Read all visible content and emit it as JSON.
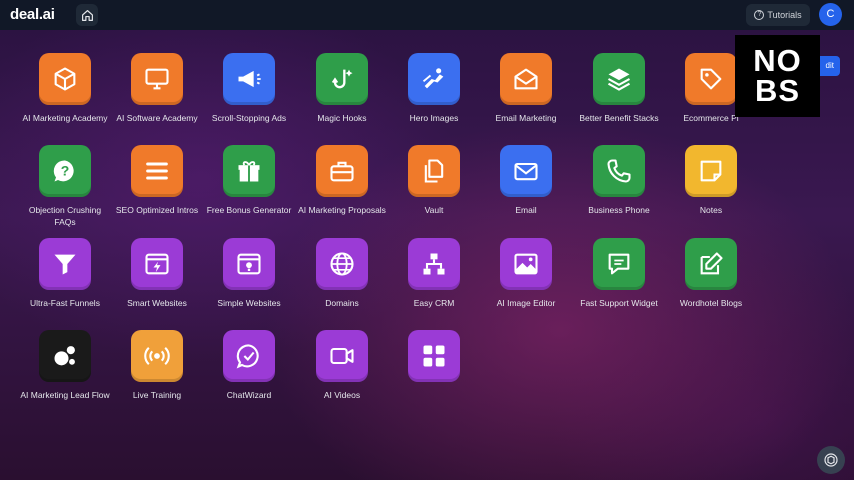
{
  "header": {
    "logo": "deal.ai",
    "tutorials_label": "Tutorials",
    "avatar_initial": "C"
  },
  "edit_button_label": "dit",
  "overlay": {
    "line1": "NO",
    "line2": "BS"
  },
  "apps": [
    {
      "label": "AI Marketing Academy",
      "icon": "cube-icon",
      "color": "#f07a2a"
    },
    {
      "label": "AI Software Academy",
      "icon": "monitor-icon",
      "color": "#f07a2a"
    },
    {
      "label": "Scroll-Stopping Ads",
      "icon": "megaphone-icon",
      "color": "#3b6ff0"
    },
    {
      "label": "Magic Hooks",
      "icon": "hook-icon",
      "color": "#2f9e4a"
    },
    {
      "label": "Hero Images",
      "icon": "hero-icon",
      "color": "#3b6ff0"
    },
    {
      "label": "Email Marketing",
      "icon": "envelope-open-icon",
      "color": "#f07a2a"
    },
    {
      "label": "Better Benefit Stacks",
      "icon": "layers-icon",
      "color": "#2f9e4a"
    },
    {
      "label": "Ecommerce Pl",
      "icon": "tag-icon",
      "color": "#f07a2a"
    },
    {
      "label": "Objection Crushing FAQs",
      "icon": "question-bubble-icon",
      "color": "#2f9e4a"
    },
    {
      "label": "SEO Optimized Intros",
      "icon": "lines-icon",
      "color": "#f07a2a"
    },
    {
      "label": "Free Bonus Generator",
      "icon": "gift-icon",
      "color": "#2f9e4a"
    },
    {
      "label": "AI Marketing Proposals",
      "icon": "briefcase-icon",
      "color": "#f07a2a"
    },
    {
      "label": "Vault",
      "icon": "documents-icon",
      "color": "#f07a2a"
    },
    {
      "label": "Email",
      "icon": "envelope-icon",
      "color": "#3b6ff0"
    },
    {
      "label": "Business Phone",
      "icon": "phone-icon",
      "color": "#2f9e4a"
    },
    {
      "label": "Notes",
      "icon": "sticky-note-icon",
      "color": "#f2b72e"
    },
    {
      "label": "Ultra-Fast Funnels",
      "icon": "funnel-icon",
      "color": "#9b3bd6"
    },
    {
      "label": "Smart Websites",
      "icon": "browser-bolt-icon",
      "color": "#9b3bd6"
    },
    {
      "label": "Simple Websites",
      "icon": "browser-bulb-icon",
      "color": "#9b3bd6"
    },
    {
      "label": "Domains",
      "icon": "globe-icon",
      "color": "#9b3bd6"
    },
    {
      "label": "Easy CRM",
      "icon": "org-chart-icon",
      "color": "#9b3bd6"
    },
    {
      "label": "AI Image Editor",
      "icon": "image-icon",
      "color": "#9b3bd6"
    },
    {
      "label": "Fast Support Widget",
      "icon": "message-icon",
      "color": "#2f9e4a"
    },
    {
      "label": "Wordhotel Blogs",
      "icon": "edit-icon",
      "color": "#2f9e4a"
    },
    {
      "label": "AI Marketing Lead Flow",
      "icon": "bubbles-icon",
      "color": "#1a1a1a"
    },
    {
      "label": "Live Training",
      "icon": "broadcast-icon",
      "color": "#f0a03a"
    },
    {
      "label": "ChatWizard",
      "icon": "chat-check-icon",
      "color": "#9b3bd6"
    },
    {
      "label": "AI Videos",
      "icon": "video-icon",
      "color": "#9b3bd6"
    },
    {
      "label": "",
      "icon": "grid-icon",
      "color": "#9b3bd6"
    }
  ]
}
